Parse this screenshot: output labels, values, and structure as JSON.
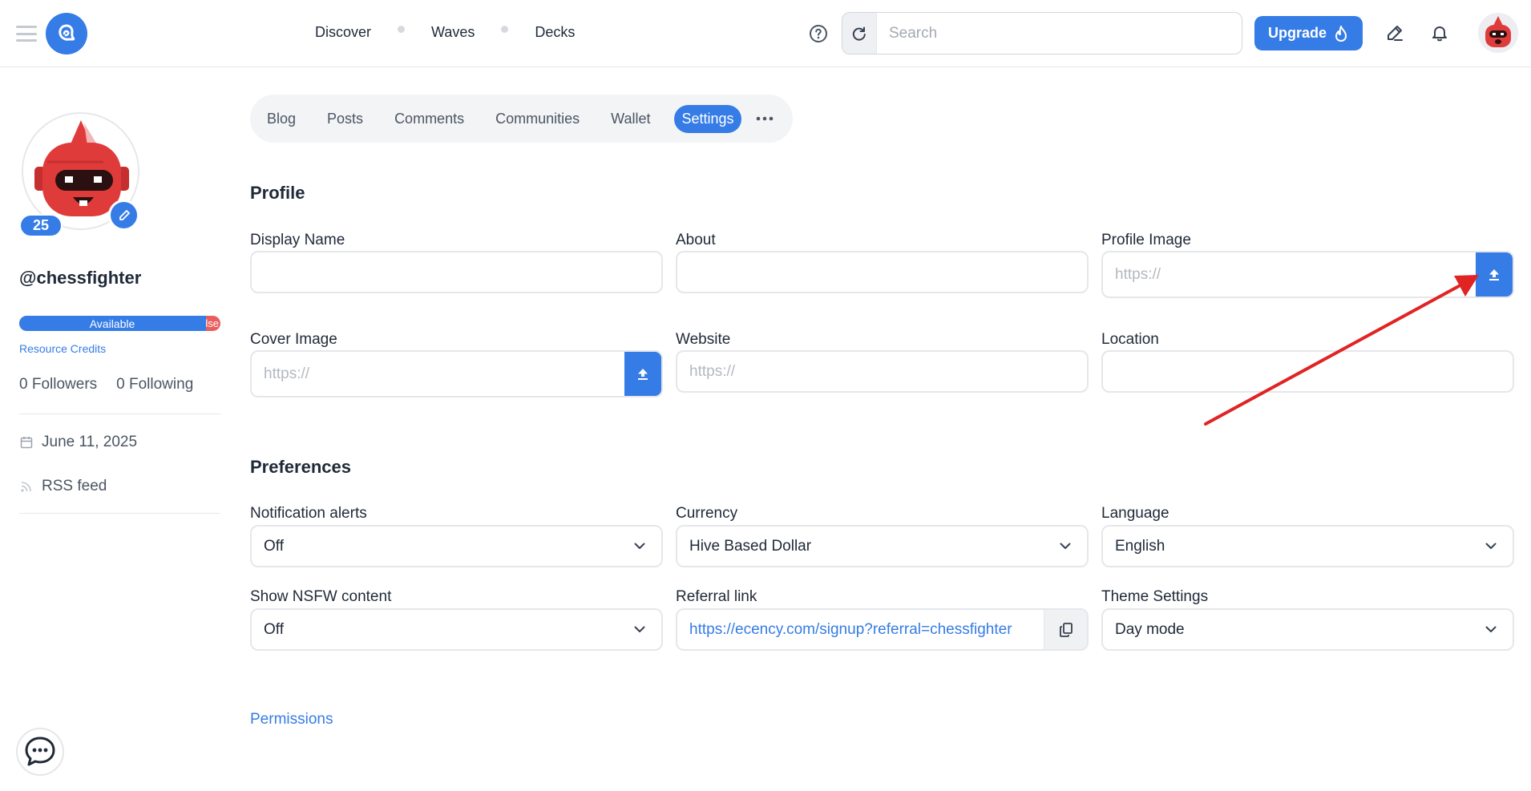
{
  "header": {
    "nav": [
      "Discover",
      "Waves",
      "Decks"
    ],
    "search_placeholder": "Search",
    "upgrade_label": "Upgrade"
  },
  "sidebar": {
    "reputation": "25",
    "username": "@chessfighter",
    "rc_available_label": "Available",
    "rc_used_label": "lse",
    "rc_available_fraction": 0.93,
    "rc_label": "Resource Credits",
    "followers": "0 Followers",
    "following": "0 Following",
    "joined": "June 11, 2025",
    "rss": "RSS feed"
  },
  "tabs": [
    "Blog",
    "Posts",
    "Comments",
    "Communities",
    "Wallet",
    "Settings"
  ],
  "active_tab": "Settings",
  "profile": {
    "title": "Profile",
    "display_name_label": "Display Name",
    "about_label": "About",
    "profile_image_label": "Profile Image",
    "profile_image_placeholder": "https://",
    "cover_image_label": "Cover Image",
    "cover_image_placeholder": "https://",
    "website_label": "Website",
    "website_placeholder": "https://",
    "location_label": "Location"
  },
  "preferences": {
    "title": "Preferences",
    "notification_label": "Notification alerts",
    "notification_value": "Off",
    "currency_label": "Currency",
    "currency_value": "Hive Based Dollar",
    "language_label": "Language",
    "language_value": "English",
    "nsfw_label": "Show NSFW content",
    "nsfw_value": "Off",
    "referral_label": "Referral link",
    "referral_value": "https://ecency.com/signup?referral=chessfighter",
    "theme_label": "Theme Settings",
    "theme_value": "Day mode"
  },
  "permissions_label": "Permissions",
  "colors": {
    "accent": "#357ce6",
    "annotation_arrow": "#e02424",
    "rc_used": "#e95d5d"
  }
}
